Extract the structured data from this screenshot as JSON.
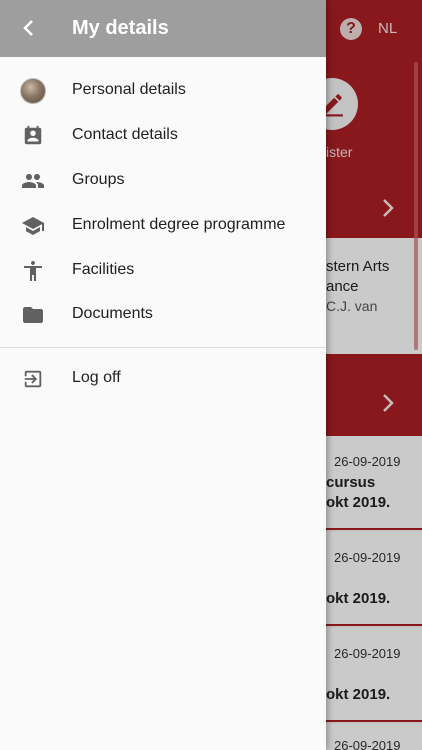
{
  "drawer": {
    "title": "My details",
    "items": [
      {
        "label": "Personal details",
        "icon": "avatar"
      },
      {
        "label": "Contact details",
        "icon": "contact-card-icon"
      },
      {
        "label": "Groups",
        "icon": "groups-icon"
      },
      {
        "label": "Enrolment degree programme",
        "icon": "graduation-cap-icon"
      },
      {
        "label": "Facilities",
        "icon": "accessibility-icon"
      },
      {
        "label": "Documents",
        "icon": "folder-icon"
      }
    ],
    "logoff": {
      "label": "Log off",
      "icon": "logout-icon"
    }
  },
  "background": {
    "help_symbol": "?",
    "language": "NL",
    "register_label": "ister",
    "course_title_line1": "stern Arts",
    "course_title_line2": "ance",
    "course_subtitle": "C.J. van",
    "items": [
      {
        "date": "26-09-2019",
        "line1": "cursus",
        "line2": "okt 2019."
      },
      {
        "date": "26-09-2019",
        "line1": "",
        "line2": "okt 2019."
      },
      {
        "date": "26-09-2019",
        "line1": "",
        "line2": "okt 2019."
      },
      {
        "date": "26-09-2019",
        "line1": "",
        "line2": ""
      }
    ]
  },
  "colors": {
    "brand_red": "#a61e22",
    "drawer_header": "#9e9e9e",
    "drawer_bg": "#fafafa",
    "icon_grey": "#616161"
  }
}
